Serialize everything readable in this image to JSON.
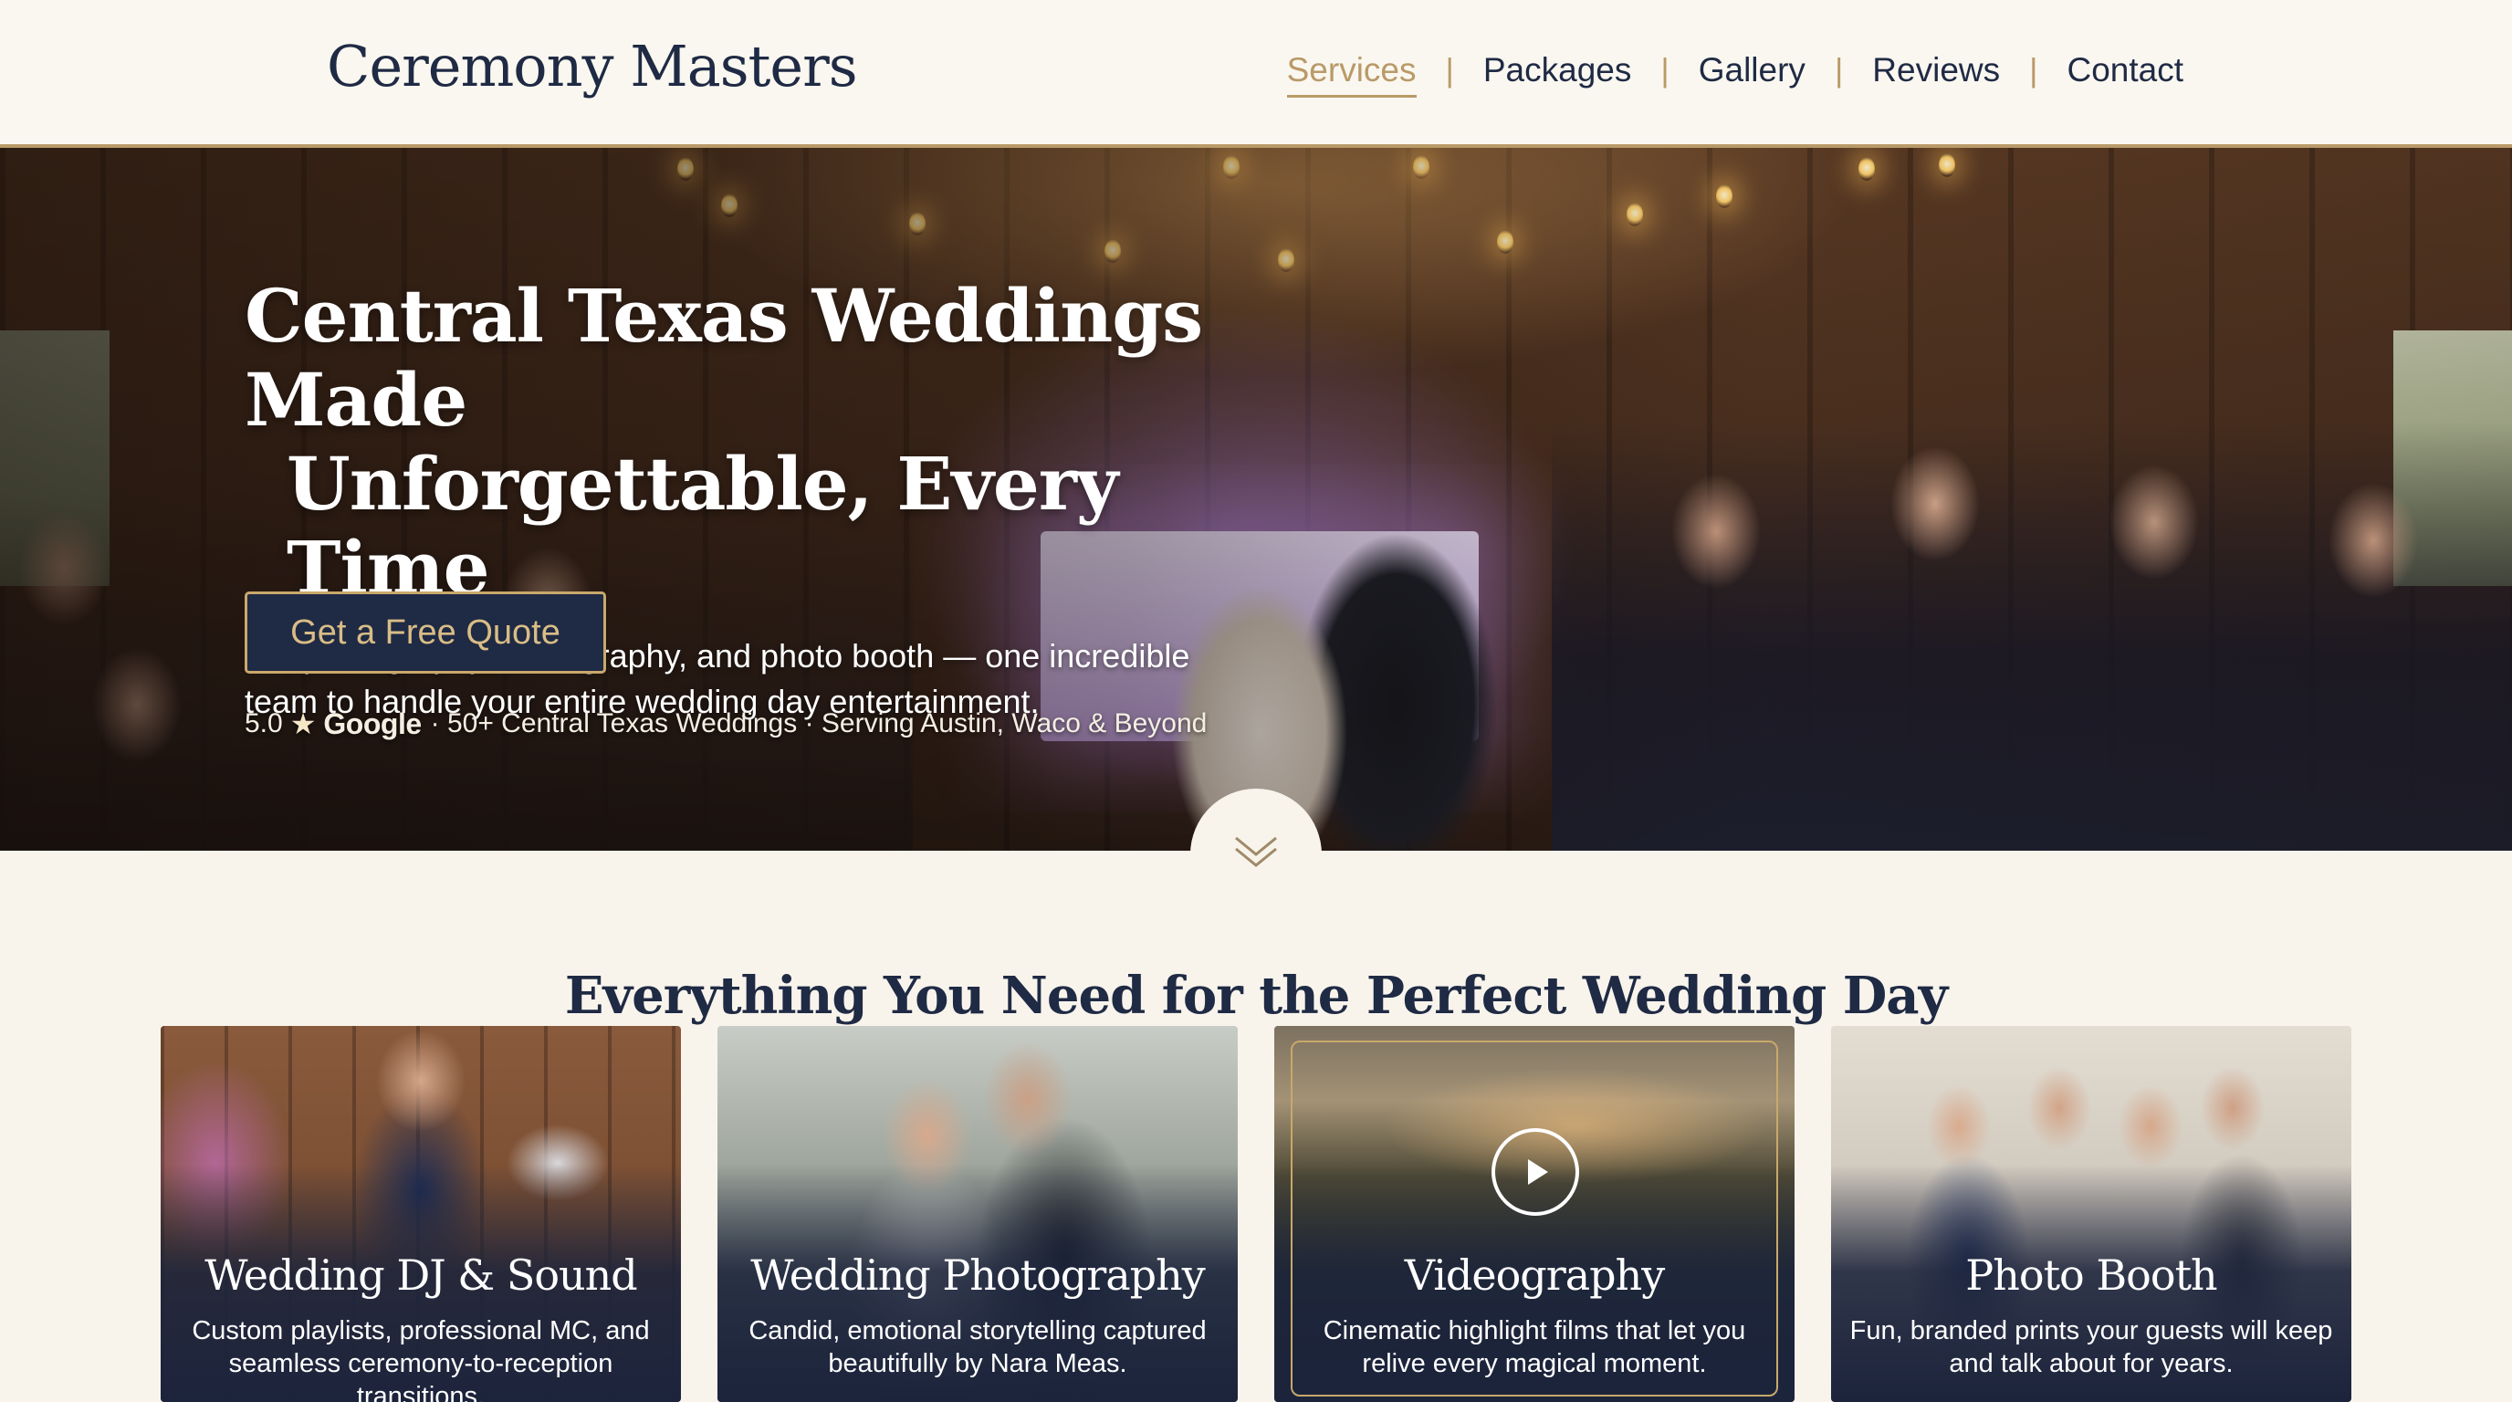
{
  "header": {
    "brand": "Ceremony Masters",
    "nav": [
      {
        "label": "Services",
        "active": true
      },
      {
        "label": "Packages",
        "active": false
      },
      {
        "label": "Gallery",
        "active": false
      },
      {
        "label": "Reviews",
        "active": false
      },
      {
        "label": "Contact",
        "active": false
      }
    ],
    "separator": "|"
  },
  "hero": {
    "title_line1": "Central Texas Weddings Made",
    "title_line2": "Unforgettable, Every Time",
    "subtitle": "DJ, photography, videography, and photo booth — one incredible team to handle your entire wedding day entertainment.",
    "cta_label": "Get a Free Quote",
    "rating_value": "5.0",
    "rating_star": "★",
    "rating_source": "Google",
    "rating_rest": "· 50+ Central Texas Weddings · Serving Austin, Waco & Beyond",
    "scroll_icon": "chevron-down-icon"
  },
  "services": {
    "title": "Everything You Need for the Perfect Wedding Day",
    "cards": [
      {
        "title": "Wedding DJ & Sound",
        "desc": "Custom playlists, professional MC, and seamless ceremony-to-reception transitions."
      },
      {
        "title": "Wedding Photography",
        "desc": "Candid, emotional storytelling captured beautifully by Nara Meas."
      },
      {
        "title": "Videography",
        "desc": "Cinematic highlight films that let you relive every magical moment."
      },
      {
        "title": "Photo Booth",
        "desc": "Fun, branded prints your guests will keep and talk about for years."
      }
    ]
  },
  "colors": {
    "navy": "#1f2a44",
    "gold": "#b99a68",
    "cream": "#f8f4ec"
  }
}
